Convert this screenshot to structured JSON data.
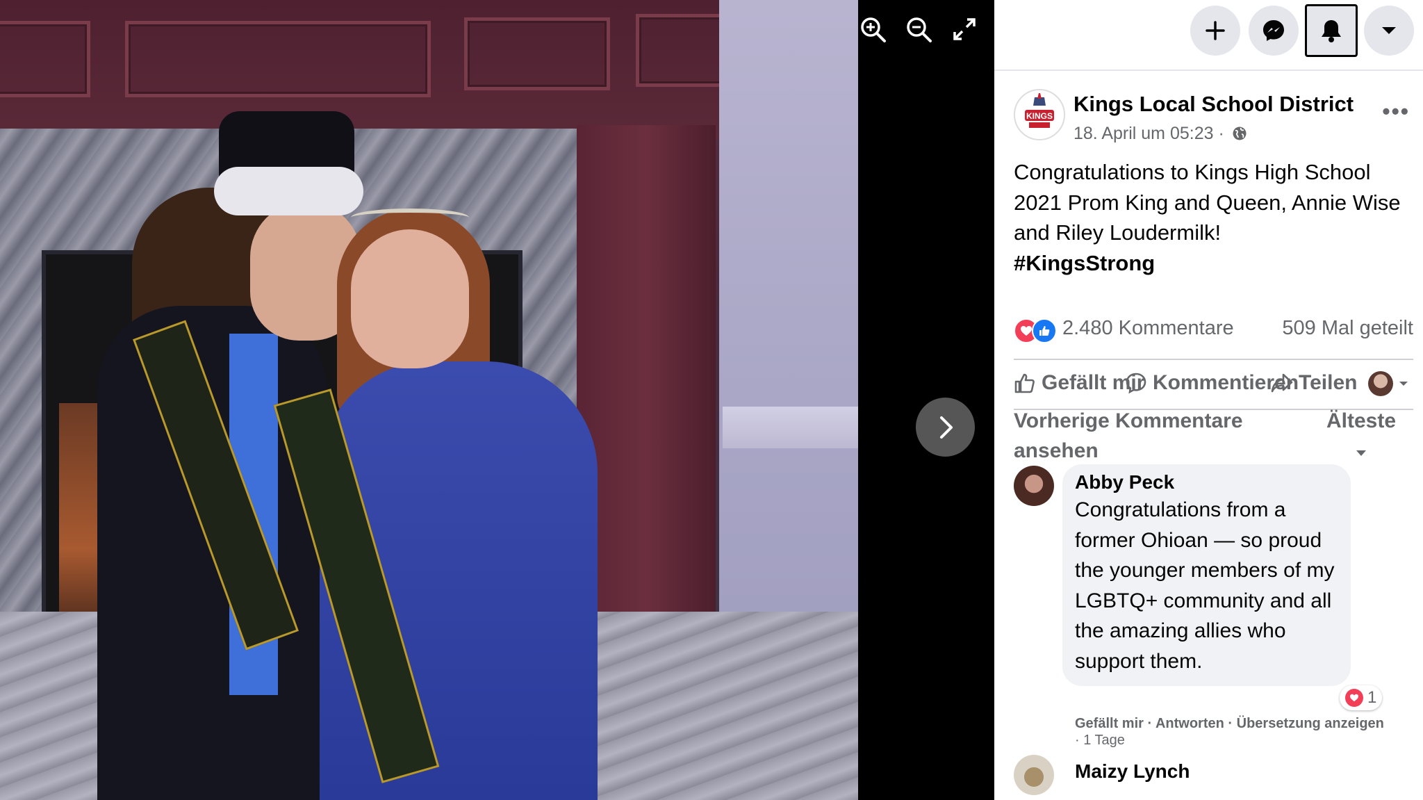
{
  "viewer": {
    "zoom_in_icon": "zoom-in-icon",
    "zoom_out_icon": "zoom-out-icon",
    "fullscreen_icon": "fullscreen-icon",
    "next_icon": "chevron-right-icon"
  },
  "topbar": {
    "buttons": [
      "plus-icon",
      "messenger-icon",
      "bell-icon",
      "caret-down-icon"
    ]
  },
  "post": {
    "page_name": "Kings Local School District",
    "timestamp": "18. April um 05:23 ·",
    "audience_icon": "globe-icon",
    "more": "•••",
    "text": "Congratulations to Kings High School 2021 Prom King and Queen, Annie Wise and Riley Loudermilk!",
    "hashtag": "#KingsStrong",
    "avatar_text": "KINGS"
  },
  "stats": {
    "comments": "2.480 Kommentare",
    "shares": "509 Mal geteilt"
  },
  "actions": {
    "like": "Gefällt mir",
    "comment": "Kommentieren",
    "share": "Teilen"
  },
  "comments_section": {
    "previous": "Vorherige Kommentare ansehen",
    "sort": "Älteste"
  },
  "comments": [
    {
      "author": "Abby Peck",
      "text": "Congratulations from a former Ohioan — so proud the younger members of my LGBTQ+ community and all the amazing allies who support them.",
      "reaction_count": "1",
      "like": "Gefällt mir",
      "reply": "Antworten",
      "translate": "Übersetzung anzeigen",
      "age": "· 1 Tage"
    },
    {
      "author": "Maizy Lynch"
    }
  ],
  "colors": {
    "accent": "#1877f2",
    "heart": "#f33e58",
    "muted_text": "#65676b"
  }
}
